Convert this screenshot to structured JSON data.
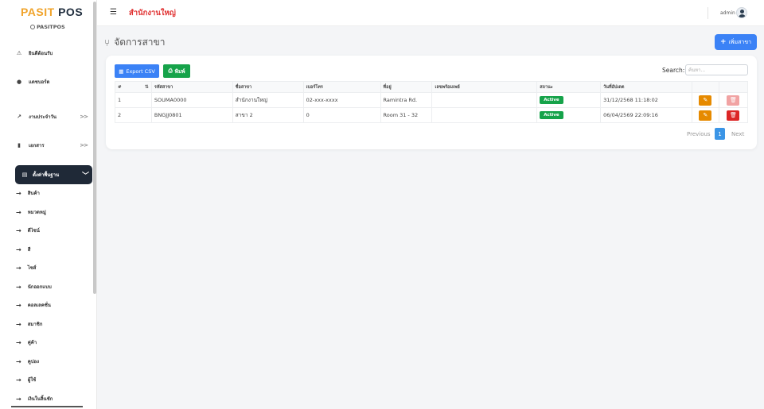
{
  "brand": {
    "name_part1": "PASIT",
    "name_part2": " POS",
    "sub": "PASITPOS"
  },
  "sidebar": {
    "items": [
      {
        "label": "ยินดีต้อนรับ",
        "icon": "warning-icon"
      },
      {
        "label": "แดชบอร์ด",
        "icon": "info-icon"
      },
      {
        "label": "งานประจำวัน",
        "icon": "trend-icon",
        "chevron": ">>"
      },
      {
        "label": "เอกสาร",
        "icon": "document-icon",
        "chevron": ">>"
      },
      {
        "label": "ตั้งค่าพื้นฐาน",
        "icon": "printer-icon",
        "chevron": "﹀"
      }
    ],
    "subitems": [
      "สินค้า",
      "หมวดหมู่",
      "ดีไซน์",
      "สี",
      "ไซส์",
      "นักออกแบบ",
      "คอลเลคชั่น",
      "สมาชิก",
      "คู่ค้า",
      "คูปอง",
      "ผู้ใช้",
      "เงินในลิ้นชัก"
    ]
  },
  "topbar": {
    "branch": "สำนักงานใหญ่",
    "user": "admin"
  },
  "page": {
    "title": "จัดการสาขา",
    "add_button": "เพิ่มสาขา"
  },
  "toolbar": {
    "export_csv": "Export CSV",
    "print": "พิมพ์",
    "search_label": "Search:",
    "search_placeholder": "ค้นหา..."
  },
  "table": {
    "headers": [
      "#",
      "รหัสสาขา",
      "ชื่อสาขา",
      "เบอร์โทร",
      "ที่อยู่",
      "เลขพร้อมเพย์",
      "สถานะ",
      "วันที่อัปเดต",
      "",
      ""
    ],
    "rows": [
      {
        "no": "1",
        "code": "SOUMA0000",
        "name": "สำนักงานใหญ่",
        "phone": "02-xxx-xxxx",
        "address": "Ramintra Rd.",
        "promptpay": "",
        "status": "Active",
        "updated": "31/12/2568 11:18:02"
      },
      {
        "no": "2",
        "code": "BNGJJ0801",
        "name": "สาขา 2",
        "phone": "0",
        "address": "Room 31 - 32",
        "promptpay": "",
        "status": "Active",
        "updated": "06/04/2569 22:09:16"
      }
    ]
  },
  "pagination": {
    "previous": "Previous",
    "current": "1",
    "next": "Next"
  },
  "colors": {
    "brand_orange": "#f0a32a",
    "primary": "#3b82f6",
    "success": "#16a34a",
    "danger": "#dc2626",
    "warning": "#e68a00",
    "sidebar_active": "#1f2937",
    "branch_red": "#e03131"
  }
}
